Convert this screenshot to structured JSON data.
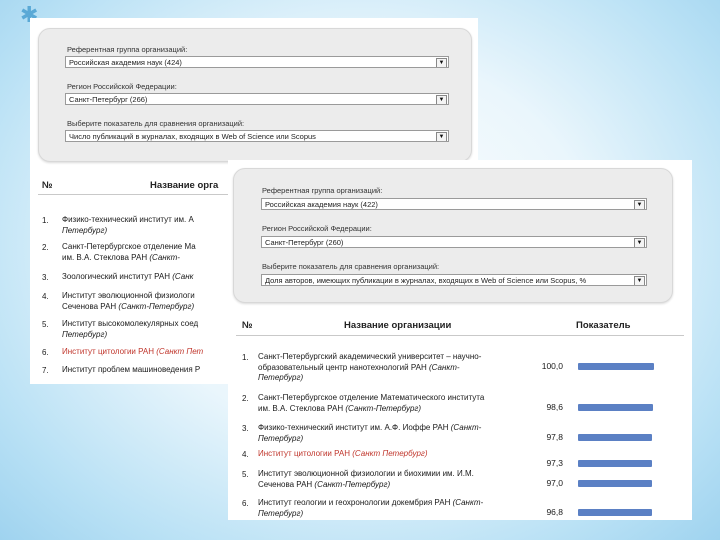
{
  "back_panel": {
    "filters": [
      {
        "label": "Референтная группа организаций:",
        "value": "Российская академия наук (424)"
      },
      {
        "label": "Регион Российской Федерации:",
        "value": "Санкт-Петербург (266)"
      },
      {
        "label": "Выберите показатель для сравнения организаций:",
        "value": "Число публикаций в журналах, входящих в Web of Science или Scopus"
      }
    ],
    "table_header": {
      "number": "№",
      "name": "Название орга"
    },
    "rows": [
      {
        "num": "1.",
        "name": [
          "Физико-технический институт им. А",
          "Петербург)"
        ],
        "hl": false
      },
      {
        "num": "2.",
        "name": [
          "Санкт-Петербургское отделение Ма",
          "им. В.А. Стеклова РАН (Санкт-"
        ],
        "hl": false
      },
      {
        "num": "3.",
        "name": [
          "Зоологический институт РАН (Санк"
        ],
        "hl": false
      },
      {
        "num": "4.",
        "name": [
          "Институт эволюционной физиологи",
          "Сеченова РАН (Санкт-Петербург)"
        ],
        "hl": false
      },
      {
        "num": "5.",
        "name": [
          "Институт высокомолекулярных соед",
          "Петербург)"
        ],
        "hl": false
      },
      {
        "num": "6.",
        "name": [
          "Институт цитологии РАН (Санкт Пет"
        ],
        "hl": true
      },
      {
        "num": "7.",
        "name": [
          "Институт проблем машиноведения Р"
        ],
        "hl": false
      }
    ]
  },
  "front_panel": {
    "filters": [
      {
        "label": "Референтная группа организаций:",
        "value": "Российская академия наук (422)"
      },
      {
        "label": "Регион Российской Федерации:",
        "value": "Санкт-Петербург (260)"
      },
      {
        "label": "Выберите показатель для сравнения организаций:",
        "value": "Доля авторов, имеющих публикации в журналах, входящих в Web of Science или Scopus, %"
      }
    ],
    "table_header": {
      "number": "№",
      "name": "Название организации",
      "value": "Показатель"
    },
    "rows": [
      {
        "num": "1.",
        "name": [
          "Санкт-Петербургский академический университет – научно-",
          "образовательный центр нанотехнологий РАН (Санкт-",
          "Петербург)"
        ],
        "value": "100,0",
        "pct": 100,
        "hl": false
      },
      {
        "num": "2.",
        "name": [
          "Санкт-Петербургское отделение Математического института",
          "им. В.А. Стеклова РАН (Санкт-Петербург)"
        ],
        "value": "98,6",
        "pct": 98.6,
        "hl": false
      },
      {
        "num": "3.",
        "name": [
          "Физико-технический институт им. А.Ф. Иоффе РАН (Санкт-",
          "Петербург)"
        ],
        "value": "97,8",
        "pct": 97.8,
        "hl": false
      },
      {
        "num": "4.",
        "name": [
          "Институт цитологии РАН (Санкт Петербург)"
        ],
        "value": "97,3",
        "pct": 97.3,
        "hl": true
      },
      {
        "num": "5.",
        "name": [
          "Институт эволюционной физиологии и биохимии им. И.М.",
          "Сеченова РАН (Санкт-Петербург)"
        ],
        "value": "97,0",
        "pct": 97.0,
        "hl": false
      },
      {
        "num": "6.",
        "name": [
          "Институт геологии и геохронологии докембрия РАН (Санкт-",
          "Петербург)"
        ],
        "value": "96,8",
        "pct": 96.8,
        "hl": false
      }
    ]
  },
  "colors": {
    "bar": "#5b80c4",
    "highlight": "#c0362c",
    "filter_bg": "#ececec"
  }
}
